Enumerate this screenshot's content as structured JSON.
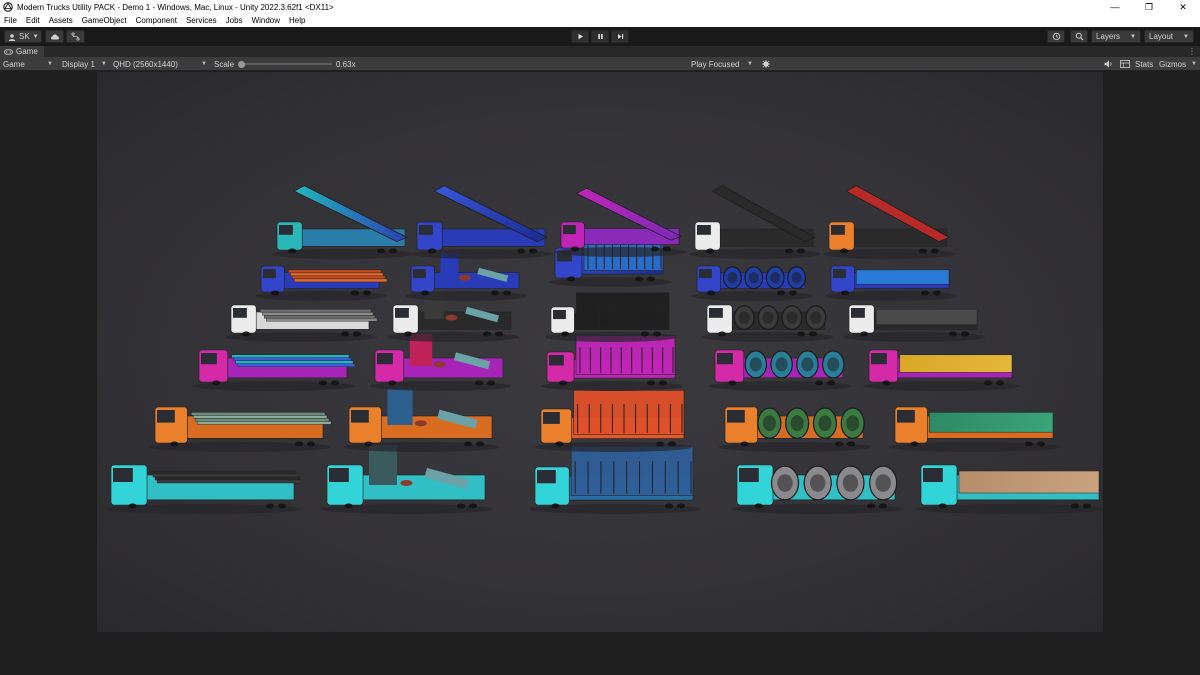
{
  "window": {
    "title": "Modern Trucks Utility PACK - Demo 1 - Windows, Mac, Linux - Unity 2022.3.62f1 <DX11>",
    "controls": {
      "minimize": "—",
      "restore": "❐",
      "close": "✕"
    }
  },
  "menu": [
    "File",
    "Edit",
    "Assets",
    "GameObject",
    "Component",
    "Services",
    "Jobs",
    "Window",
    "Help"
  ],
  "toolbar": {
    "account": "SK",
    "layers": "Layers",
    "layout": "Layout"
  },
  "tab": {
    "label": "Game"
  },
  "gamebar": {
    "mode": "Game",
    "display": "Display 1",
    "resolution": "QHD (2560x1440)",
    "scale_label": "Scale",
    "scale_value": "0.63x",
    "scale_level": 0.0,
    "play_mode": "Play Focused",
    "stats": "Stats",
    "gizmos": "Gizmos"
  },
  "scene": {
    "colors": {
      "background": "#38373b",
      "row1": "#2bc4c8",
      "row2": "#e77a2a",
      "row3": "#c0239a",
      "row4": "#e8e8e8",
      "row5": "#2a3bb8",
      "ramp_gradient": "#7a3db8"
    }
  }
}
